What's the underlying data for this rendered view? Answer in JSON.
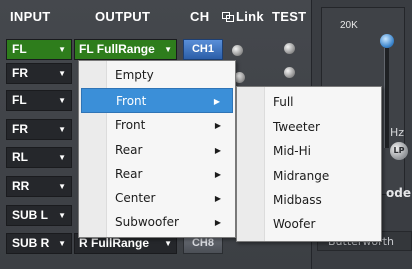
{
  "header": {
    "input": "INPUT",
    "output": "OUTPUT",
    "ch": "CH",
    "link": "Link",
    "test": "TEST"
  },
  "rows": [
    {
      "input": "FL",
      "output": "FL FullRange",
      "ch": "CH1"
    },
    {
      "input": "FR",
      "output": "",
      "ch": ""
    },
    {
      "input": "FL",
      "output": "",
      "ch": ""
    },
    {
      "input": "FR",
      "output": "",
      "ch": ""
    },
    {
      "input": "RL",
      "output": "",
      "ch": ""
    },
    {
      "input": "RR",
      "output": "",
      "ch": ""
    },
    {
      "input": "SUB L",
      "output": "",
      "ch": ""
    },
    {
      "input": "SUB R",
      "output": "R FullRange",
      "ch": "CH8"
    }
  ],
  "menu": {
    "items": [
      {
        "label": "Empty"
      },
      {
        "label": "Front"
      },
      {
        "label": "Front"
      },
      {
        "label": "Rear"
      },
      {
        "label": "Rear"
      },
      {
        "label": "Center"
      },
      {
        "label": "Subwoofer"
      }
    ],
    "submenu": [
      {
        "label": "Full"
      },
      {
        "label": "Tweeter"
      },
      {
        "label": "Mid-Hi"
      },
      {
        "label": "Midrange"
      },
      {
        "label": "Midbass"
      },
      {
        "label": "Woofer"
      }
    ]
  },
  "right_panel": {
    "freq_label": "20K",
    "hz_fragment": "Hz",
    "lp_label": "LP",
    "model_fragment": "odel",
    "filter_fragment": "Butterworth"
  },
  "colors": {
    "active_green": "#2e7d1c",
    "ch_blue": "#2b5ea8",
    "menu_highlight": "#3b8fd8"
  }
}
